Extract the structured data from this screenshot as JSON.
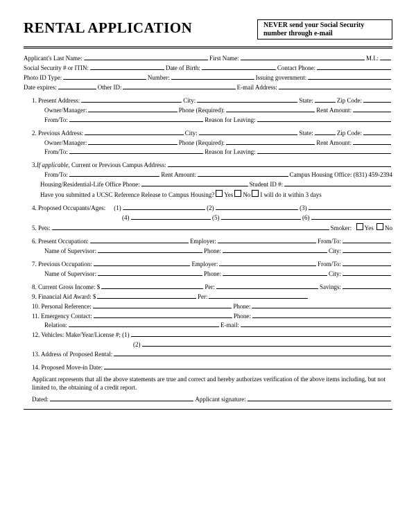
{
  "title": "RENTAL APPLICATION",
  "warning_l1": "NEVER send your Social Security",
  "warning_l2": "number through e-mail",
  "hdr": {
    "last": "Applicant's Last Name:",
    "first": "First Name:",
    "mi": "M.I.:",
    "ssn": "Social Security # or ITIN:",
    "dob": "Date of Birth:",
    "contact": "Contact Phone:",
    "idtype": "Photo ID Type:",
    "num": "Number:",
    "issue": "Issuing government:",
    "expires": "Date expires:",
    "otherid": "Other ID:",
    "email": "E-mail Address:"
  },
  "s1": {
    "t": "1. Present Address:",
    "city": "City:",
    "state": "State:",
    "zip": "Zip Code:",
    "owner": "Owner/Manager:",
    "phone": "Phone (Required):",
    "rent": "Rent Amount:",
    "from": "From/To:",
    "reason": "Reason for Leaving:"
  },
  "s2": {
    "t": "2. Previous Address:"
  },
  "s3": {
    "t": "3. ",
    "tail": ", Current or Previous Campus Address:",
    "if": "If applicable",
    "from": "From/To:",
    "rent": "Rent Amount:",
    "office": "Campus Housing Office: (831) 459-2394",
    "hphone": "Housing/Residential-Life Office Phone:",
    "sid": "Student ID #:",
    "ref": "Have you submitted a UCSC Reference Release to Campus Housing?",
    "yes": "Yes",
    "no": "No",
    "dothree": "I will do it within 3 days"
  },
  "s4": {
    "t": "4. Proposed Occupants/Ages:",
    "p1": "(1)",
    "p2": "(2)",
    "p3": "(3)",
    "p4": "(4)",
    "p5": "(5)",
    "p6": "(6)"
  },
  "s5": {
    "t": "5. Pets:",
    "smoker": "Smoker:",
    "yes": "Yes",
    "no": "No"
  },
  "s6": {
    "t": "6. Present Occupation:",
    "emp": "Employer:",
    "from": "From/To:",
    "sup": "Name of Supervisor:",
    "ph": "Phone:",
    "city": "City:"
  },
  "s7": {
    "t": "7. Previous Occupation:"
  },
  "s8": {
    "t": "8. Current Gross Income: $",
    "per": "Per:",
    "sav": "Savings:"
  },
  "s9": {
    "t": "9. Financial Aid Award: $",
    "per": "Per:"
  },
  "s10": {
    "t": "10. Personal Reference:",
    "ph": "Phone:"
  },
  "s11": {
    "t": "11. Emergency Contact:",
    "ph": "Phone:",
    "rel": "Relation:",
    "em": "E-mail:"
  },
  "s12": {
    "t": "12. Vehicles: Make/Year/License #: (1)",
    "p2": "(2)"
  },
  "s13": {
    "t": "13. Address of Proposed Rental:"
  },
  "s14": {
    "t": "14. Proposed Move-in Date:"
  },
  "cert": "Applicant represents that all the above statements are true and correct and hereby authorizes verification of the above items including, but not limited to, the obtaining of a credit report.",
  "dated": "Dated:",
  "sig": "Applicant signature:"
}
